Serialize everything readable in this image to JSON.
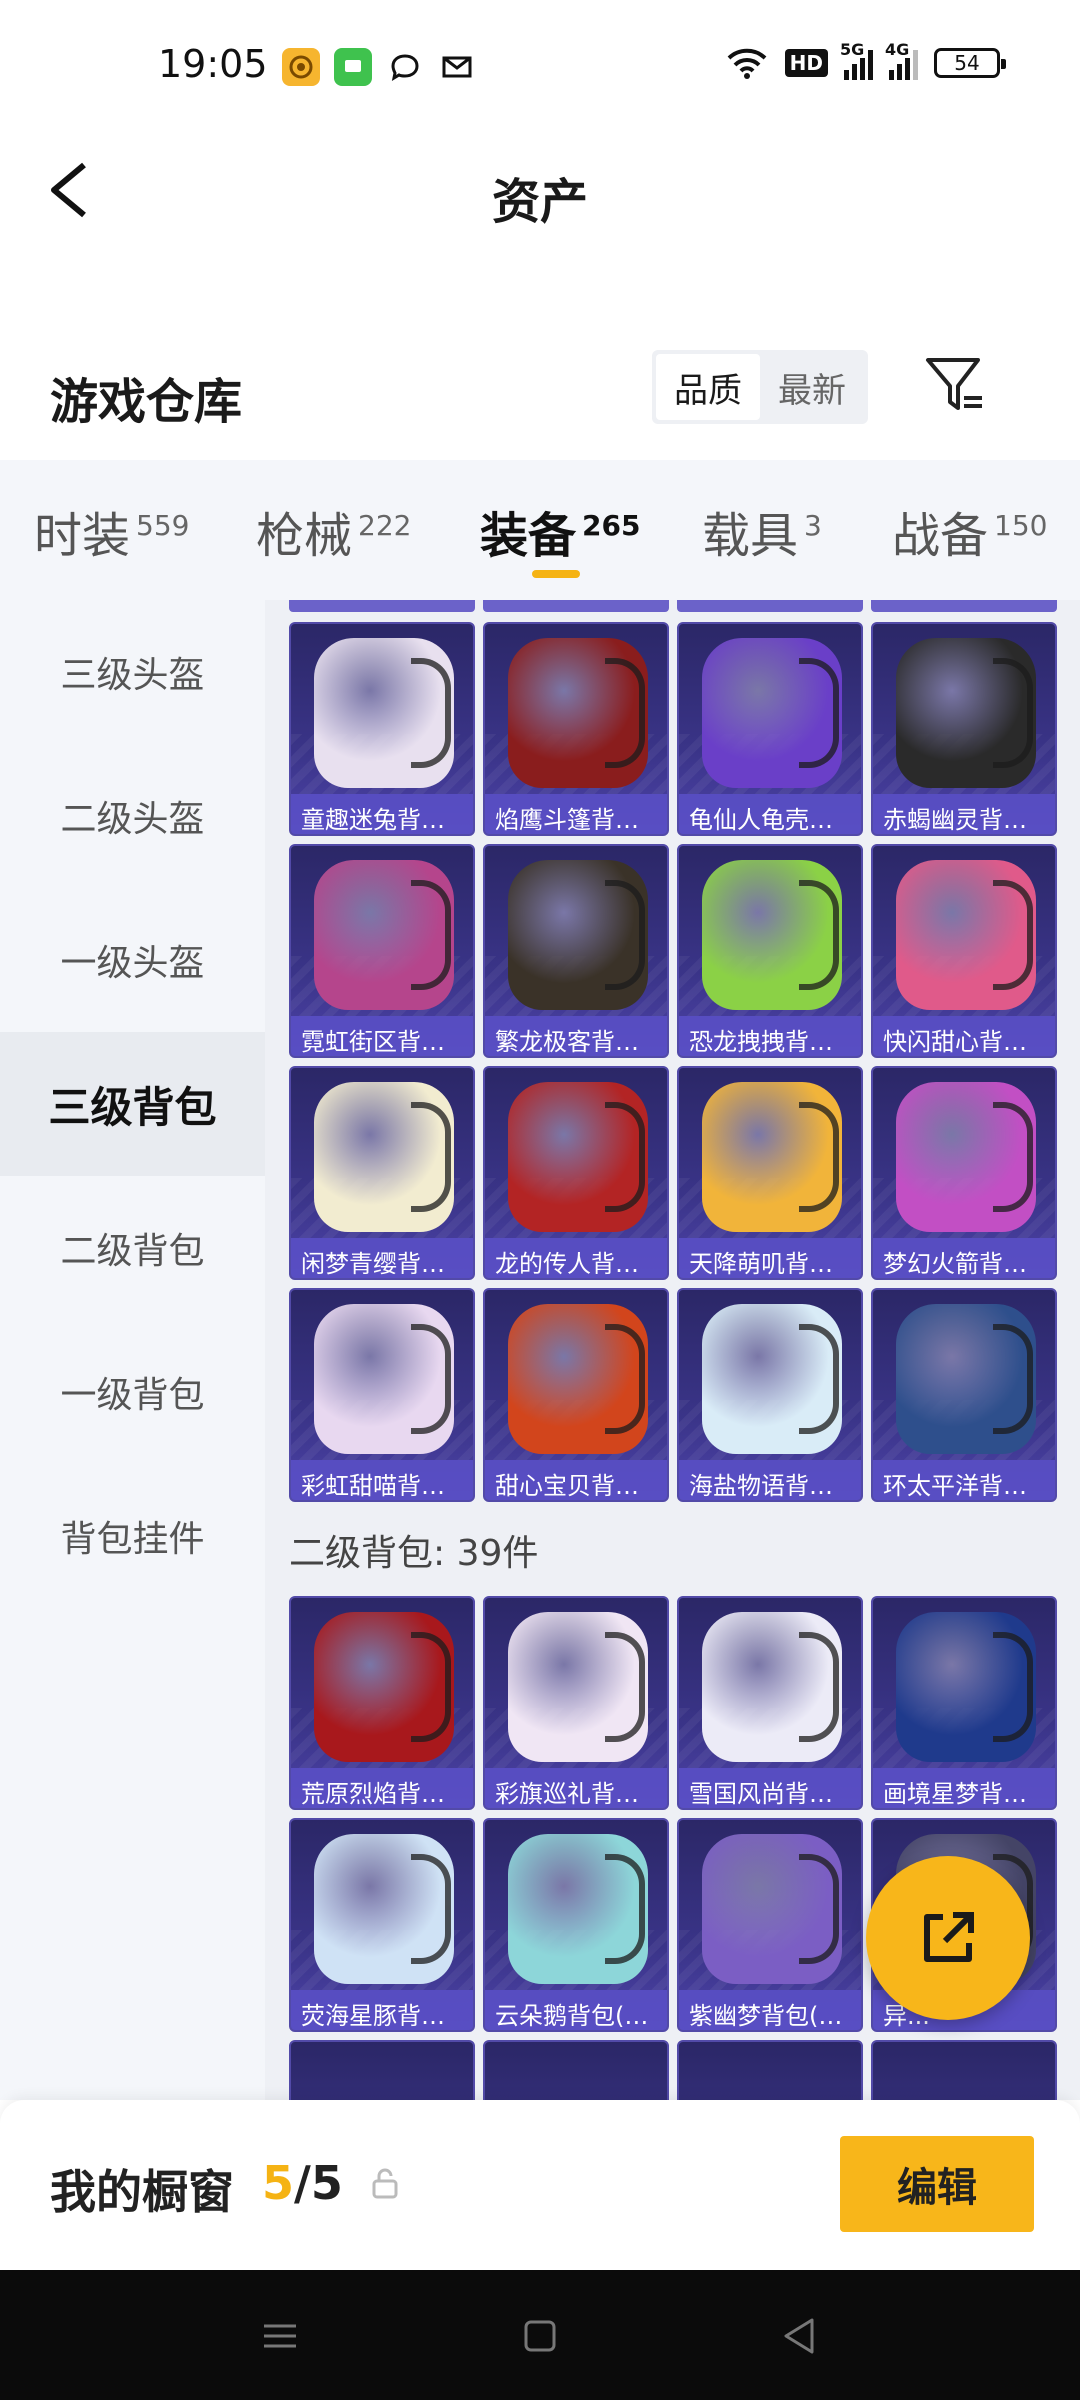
{
  "status_bar": {
    "time": "19:05",
    "hd": "HD",
    "sig1": "5G",
    "sig2": "4G",
    "battery": "54"
  },
  "header": {
    "title": "资产"
  },
  "section": {
    "title": "游戏仓库",
    "sort_options": [
      "品质",
      "最新"
    ],
    "active_sort": "品质"
  },
  "tabs": [
    {
      "label": "时装",
      "count": "559"
    },
    {
      "label": "枪械",
      "count": "222"
    },
    {
      "label": "装备",
      "count": "265"
    },
    {
      "label": "载具",
      "count": "3"
    },
    {
      "label": "战备",
      "count": "150"
    }
  ],
  "active_tab": "装备",
  "sidebar": {
    "items": [
      {
        "label": "三级头盔"
      },
      {
        "label": "二级头盔"
      },
      {
        "label": "一级头盔"
      },
      {
        "label": "三级背包"
      },
      {
        "label": "二级背包"
      },
      {
        "label": "一级背包"
      },
      {
        "label": "背包挂件"
      }
    ],
    "active": "三级背包"
  },
  "grid": {
    "level3_items": [
      "童趣迷兔背包...",
      "焰鹰斗篷背包...",
      "龟仙人龟壳背...",
      "赤蝎幽灵背包...",
      "霓虹街区背包...",
      "繁龙极客背包...",
      "恐龙拽拽背包...",
      "快闪甜心背包...",
      "闲梦青缨背包...",
      "龙的传人背包...",
      "天降萌叽背包...",
      "梦幻火箭背包...",
      "彩虹甜喵背包...",
      "甜心宝贝背包...",
      "海盐物语背包...",
      "环太平洋背包..."
    ],
    "group_label": "二级背包: 39件",
    "level2_items": [
      "荒原烈焰背包...",
      "彩旗巡礼背包...",
      "雪国风尚背包...",
      "画境星梦背包...",
      "荧海星豚背包...",
      "云朵鹅背包(2...",
      "紫幽梦背包(2...",
      "异..."
    ],
    "item_colors": [
      "#e8e0ef",
      "#8a1d1d",
      "#6a3fc8",
      "#2a2a2a",
      "#b5458c",
      "#3a3228",
      "#8bd146",
      "#e05a8a",
      "#f2ecd0",
      "#b32424",
      "#f1b43a",
      "#c24fc4",
      "#e8d8f0",
      "#d2451c",
      "#d9ecf7",
      "#2e4f8c",
      "#a8181c",
      "#f0e6f4",
      "#ecebf7",
      "#1f3a8c",
      "#cfe2f5",
      "#8dd6d9",
      "#7b5ec4",
      "#444466"
    ]
  },
  "showcase": {
    "label": "我的橱窗",
    "current": "5",
    "separator": "/",
    "total": "5",
    "edit_label": "编辑"
  }
}
